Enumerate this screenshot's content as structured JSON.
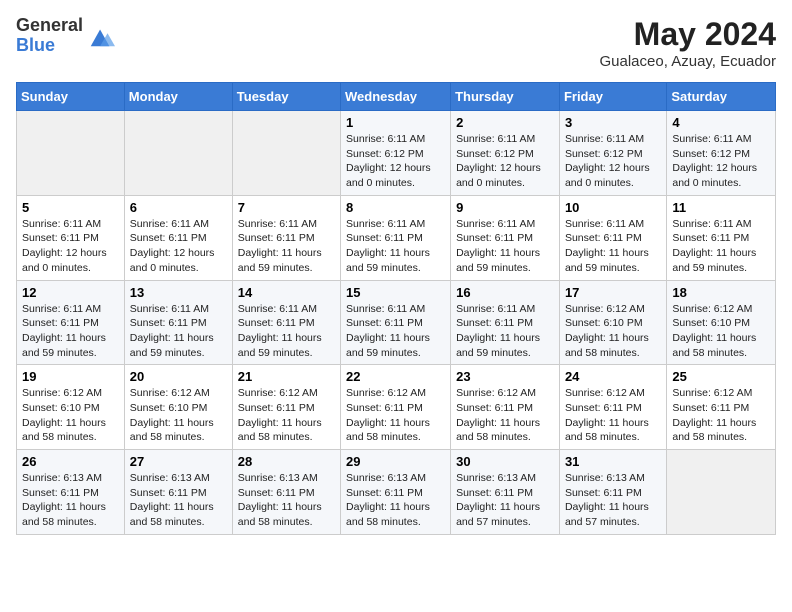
{
  "header": {
    "logo": {
      "general": "General",
      "blue": "Blue"
    },
    "month_year": "May 2024",
    "location": "Gualaceo, Azuay, Ecuador"
  },
  "days_of_week": [
    "Sunday",
    "Monday",
    "Tuesday",
    "Wednesday",
    "Thursday",
    "Friday",
    "Saturday"
  ],
  "weeks": [
    [
      {
        "day": "",
        "info": ""
      },
      {
        "day": "",
        "info": ""
      },
      {
        "day": "",
        "info": ""
      },
      {
        "day": "1",
        "info": "Sunrise: 6:11 AM\nSunset: 6:12 PM\nDaylight: 12 hours and 0 minutes."
      },
      {
        "day": "2",
        "info": "Sunrise: 6:11 AM\nSunset: 6:12 PM\nDaylight: 12 hours and 0 minutes."
      },
      {
        "day": "3",
        "info": "Sunrise: 6:11 AM\nSunset: 6:12 PM\nDaylight: 12 hours and 0 minutes."
      },
      {
        "day": "4",
        "info": "Sunrise: 6:11 AM\nSunset: 6:12 PM\nDaylight: 12 hours and 0 minutes."
      }
    ],
    [
      {
        "day": "5",
        "info": "Sunrise: 6:11 AM\nSunset: 6:11 PM\nDaylight: 12 hours and 0 minutes."
      },
      {
        "day": "6",
        "info": "Sunrise: 6:11 AM\nSunset: 6:11 PM\nDaylight: 12 hours and 0 minutes."
      },
      {
        "day": "7",
        "info": "Sunrise: 6:11 AM\nSunset: 6:11 PM\nDaylight: 11 hours and 59 minutes."
      },
      {
        "day": "8",
        "info": "Sunrise: 6:11 AM\nSunset: 6:11 PM\nDaylight: 11 hours and 59 minutes."
      },
      {
        "day": "9",
        "info": "Sunrise: 6:11 AM\nSunset: 6:11 PM\nDaylight: 11 hours and 59 minutes."
      },
      {
        "day": "10",
        "info": "Sunrise: 6:11 AM\nSunset: 6:11 PM\nDaylight: 11 hours and 59 minutes."
      },
      {
        "day": "11",
        "info": "Sunrise: 6:11 AM\nSunset: 6:11 PM\nDaylight: 11 hours and 59 minutes."
      }
    ],
    [
      {
        "day": "12",
        "info": "Sunrise: 6:11 AM\nSunset: 6:11 PM\nDaylight: 11 hours and 59 minutes."
      },
      {
        "day": "13",
        "info": "Sunrise: 6:11 AM\nSunset: 6:11 PM\nDaylight: 11 hours and 59 minutes."
      },
      {
        "day": "14",
        "info": "Sunrise: 6:11 AM\nSunset: 6:11 PM\nDaylight: 11 hours and 59 minutes."
      },
      {
        "day": "15",
        "info": "Sunrise: 6:11 AM\nSunset: 6:11 PM\nDaylight: 11 hours and 59 minutes."
      },
      {
        "day": "16",
        "info": "Sunrise: 6:11 AM\nSunset: 6:11 PM\nDaylight: 11 hours and 59 minutes."
      },
      {
        "day": "17",
        "info": "Sunrise: 6:12 AM\nSunset: 6:10 PM\nDaylight: 11 hours and 58 minutes."
      },
      {
        "day": "18",
        "info": "Sunrise: 6:12 AM\nSunset: 6:10 PM\nDaylight: 11 hours and 58 minutes."
      }
    ],
    [
      {
        "day": "19",
        "info": "Sunrise: 6:12 AM\nSunset: 6:10 PM\nDaylight: 11 hours and 58 minutes."
      },
      {
        "day": "20",
        "info": "Sunrise: 6:12 AM\nSunset: 6:10 PM\nDaylight: 11 hours and 58 minutes."
      },
      {
        "day": "21",
        "info": "Sunrise: 6:12 AM\nSunset: 6:11 PM\nDaylight: 11 hours and 58 minutes."
      },
      {
        "day": "22",
        "info": "Sunrise: 6:12 AM\nSunset: 6:11 PM\nDaylight: 11 hours and 58 minutes."
      },
      {
        "day": "23",
        "info": "Sunrise: 6:12 AM\nSunset: 6:11 PM\nDaylight: 11 hours and 58 minutes."
      },
      {
        "day": "24",
        "info": "Sunrise: 6:12 AM\nSunset: 6:11 PM\nDaylight: 11 hours and 58 minutes."
      },
      {
        "day": "25",
        "info": "Sunrise: 6:12 AM\nSunset: 6:11 PM\nDaylight: 11 hours and 58 minutes."
      }
    ],
    [
      {
        "day": "26",
        "info": "Sunrise: 6:13 AM\nSunset: 6:11 PM\nDaylight: 11 hours and 58 minutes."
      },
      {
        "day": "27",
        "info": "Sunrise: 6:13 AM\nSunset: 6:11 PM\nDaylight: 11 hours and 58 minutes."
      },
      {
        "day": "28",
        "info": "Sunrise: 6:13 AM\nSunset: 6:11 PM\nDaylight: 11 hours and 58 minutes."
      },
      {
        "day": "29",
        "info": "Sunrise: 6:13 AM\nSunset: 6:11 PM\nDaylight: 11 hours and 58 minutes."
      },
      {
        "day": "30",
        "info": "Sunrise: 6:13 AM\nSunset: 6:11 PM\nDaylight: 11 hours and 57 minutes."
      },
      {
        "day": "31",
        "info": "Sunrise: 6:13 AM\nSunset: 6:11 PM\nDaylight: 11 hours and 57 minutes."
      },
      {
        "day": "",
        "info": ""
      }
    ]
  ]
}
